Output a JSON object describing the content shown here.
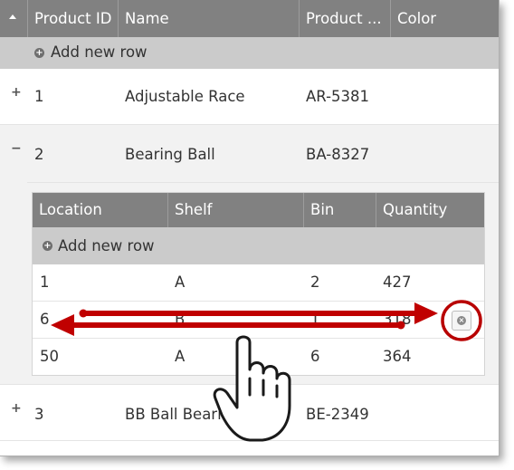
{
  "grid": {
    "columns": [
      "Product ID",
      "Name",
      "Product ...",
      "Color"
    ],
    "add_row_label": "Add new row",
    "rows": [
      {
        "expander": "+",
        "id": "1",
        "name": "Adjustable Race",
        "number": "AR-5381"
      },
      {
        "expander": "−",
        "id": "2",
        "name": "Bearing Ball",
        "number": "BA-8327"
      },
      {
        "expander": "+",
        "id": "3",
        "name": "BB Ball Bearing",
        "number": "BE-2349"
      }
    ]
  },
  "detail": {
    "columns": [
      "Location",
      "Shelf",
      "Bin",
      "Quantity"
    ],
    "add_row_label": "Add new row",
    "rows": [
      {
        "location": "1",
        "shelf": "A",
        "bin": "2",
        "quantity": "427"
      },
      {
        "location": "6",
        "shelf": "B",
        "bin": "1",
        "quantity": "318"
      },
      {
        "location": "50",
        "shelf": "A",
        "bin": "6",
        "quantity": "364"
      }
    ]
  },
  "colors": {
    "header_bg": "#818181",
    "add_row_bg": "#cbcbcb",
    "swipe_arrow": "#c00000"
  },
  "icons": {
    "delete": "x-circle-icon",
    "gesture": "hand-pointer-icon",
    "add": "plus-circle-icon"
  }
}
